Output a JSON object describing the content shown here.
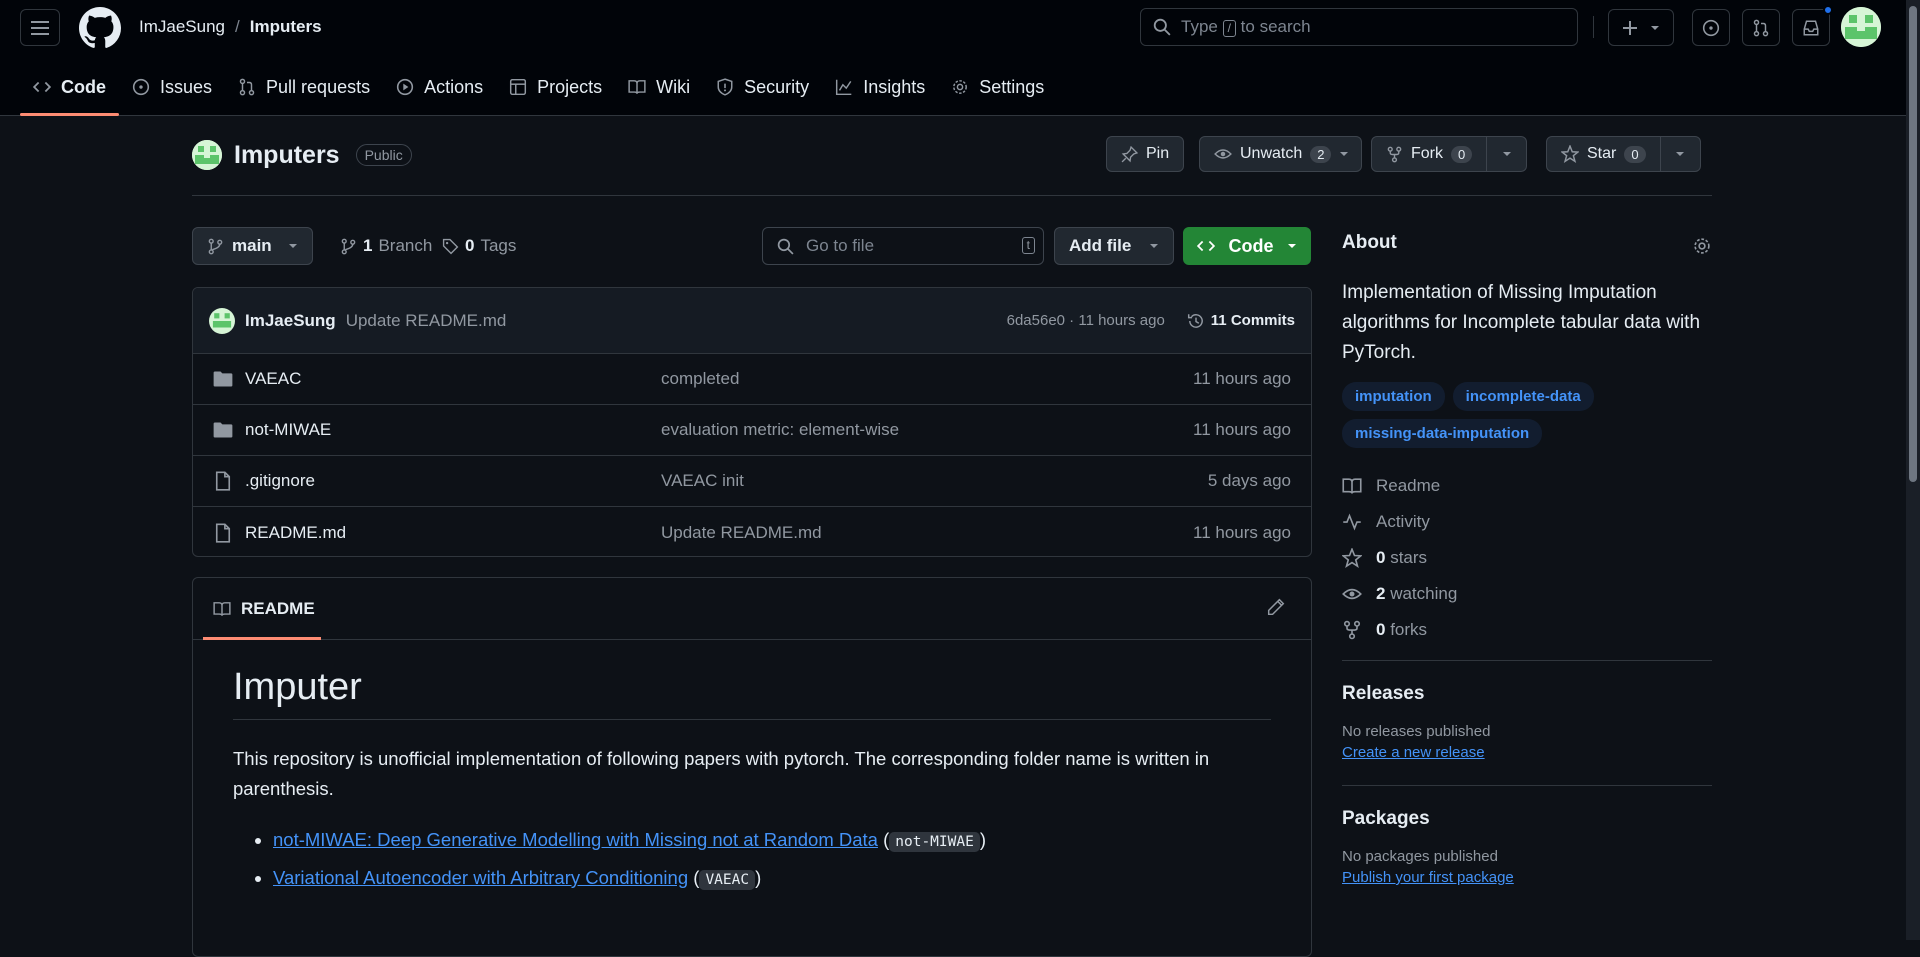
{
  "header": {
    "owner": "ImJaeSung",
    "separator": "/",
    "repo": "Imputers",
    "search_placeholder_prefix": "Type",
    "search_key": "/",
    "search_placeholder_suffix": "to search"
  },
  "tabs": [
    {
      "label": "Code",
      "icon": "code-icon"
    },
    {
      "label": "Issues",
      "icon": "issue-icon"
    },
    {
      "label": "Pull requests",
      "icon": "pull-request-icon"
    },
    {
      "label": "Actions",
      "icon": "play-icon"
    },
    {
      "label": "Projects",
      "icon": "table-icon"
    },
    {
      "label": "Wiki",
      "icon": "book-icon"
    },
    {
      "label": "Security",
      "icon": "shield-icon"
    },
    {
      "label": "Insights",
      "icon": "graph-icon"
    },
    {
      "label": "Settings",
      "icon": "gear-icon"
    }
  ],
  "repo": {
    "name": "Imputers",
    "visibility": "Public",
    "pin_label": "Pin",
    "unwatch_label": "Unwatch",
    "watch_count": "2",
    "fork_label": "Fork",
    "fork_count": "0",
    "star_label": "Star",
    "star_count": "0"
  },
  "branchbar": {
    "branch": "main",
    "branch_count": "1",
    "branch_word": "Branch",
    "tag_count": "0",
    "tag_word": "Tags",
    "go_to_file": "Go to file",
    "go_to_file_key": "t",
    "add_file": "Add file",
    "code": "Code"
  },
  "latest_commit": {
    "author": "ImJaeSung",
    "message": "Update README.md",
    "meta": "6da56e0 · 11 hours ago",
    "commits": "11 Commits"
  },
  "files": [
    {
      "name": "VAEAC",
      "type": "folder",
      "commit": "completed",
      "time": "11 hours ago"
    },
    {
      "name": "not-MIWAE",
      "type": "folder",
      "commit": "evaluation metric: element-wise",
      "time": "11 hours ago"
    },
    {
      "name": ".gitignore",
      "type": "file",
      "commit": "VAEAC init",
      "time": "5 days ago"
    },
    {
      "name": "README.md",
      "type": "file",
      "commit": "Update README.md",
      "time": "11 hours ago"
    }
  ],
  "readme": {
    "tab": "README",
    "title": "Imputer",
    "intro": "This repository is unofficial implementation of following papers with pytorch. The corresponding folder name is written in parenthesis.",
    "items": [
      {
        "link": "not-MIWAE: Deep Generative Modelling with Missing not at Random Data",
        "code": "not-MIWAE"
      },
      {
        "link": "Variational Autoencoder with Arbitrary Conditioning",
        "code": "VAEAC"
      }
    ]
  },
  "about": {
    "title": "About",
    "description": "Implementation of Missing Imputation algorithms for Incomplete tabular data with PyTorch.",
    "topics": [
      "imputation",
      "incomplete-data",
      "missing-data-imputation"
    ],
    "readme": "Readme",
    "activity": "Activity",
    "stars_count": "0",
    "stars_word": "stars",
    "watching_count": "2",
    "watching_word": "watching",
    "forks_count": "0",
    "forks_word": "forks"
  },
  "releases": {
    "title": "Releases",
    "empty": "No releases published",
    "link": "Create a new release"
  },
  "packages": {
    "title": "Packages",
    "empty": "No packages published",
    "link": "Publish your first package"
  },
  "colors": {
    "accent_green": "#238636",
    "link_blue": "#4493f8",
    "tab_underline": "#fd8c73"
  }
}
